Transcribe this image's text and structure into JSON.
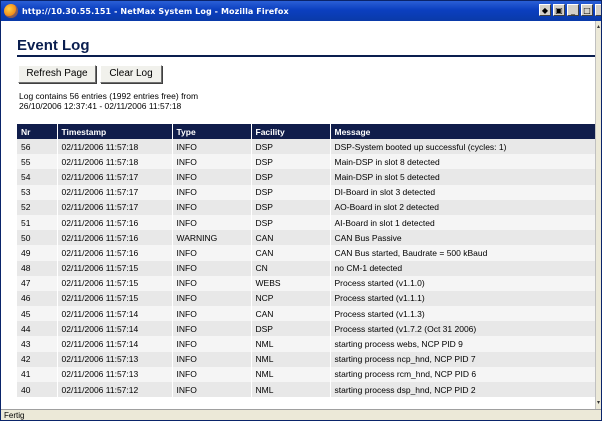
{
  "window": {
    "title": "http://10.30.55.151 - NetMax System Log - Mozilla Firefox"
  },
  "page": {
    "title": "Event Log",
    "refresh_label": "Refresh Page",
    "clear_label": "Clear Log",
    "summary_line1": "Log contains 56 entries (1992 entries free) from",
    "summary_line2": "26/10/2006 12:37:41 - 02/11/2006 11:57:18"
  },
  "table": {
    "headers": {
      "nr": "Nr",
      "timestamp": "Timestamp",
      "type": "Type",
      "facility": "Facility",
      "message": "Message"
    },
    "rows": [
      {
        "nr": "56",
        "timestamp": "02/11/2006 11:57:18",
        "type": "INFO",
        "facility": "DSP",
        "message": "DSP-System booted up successful (cycles: 1)"
      },
      {
        "nr": "55",
        "timestamp": "02/11/2006 11:57:18",
        "type": "INFO",
        "facility": "DSP",
        "message": "Main-DSP in slot 8 detected"
      },
      {
        "nr": "54",
        "timestamp": "02/11/2006 11:57:17",
        "type": "INFO",
        "facility": "DSP",
        "message": "Main-DSP in slot 5 detected"
      },
      {
        "nr": "53",
        "timestamp": "02/11/2006 11:57:17",
        "type": "INFO",
        "facility": "DSP",
        "message": "DI-Board in slot 3 detected"
      },
      {
        "nr": "52",
        "timestamp": "02/11/2006 11:57:17",
        "type": "INFO",
        "facility": "DSP",
        "message": "AO-Board in slot 2 detected"
      },
      {
        "nr": "51",
        "timestamp": "02/11/2006 11:57:16",
        "type": "INFO",
        "facility": "DSP",
        "message": "AI-Board in slot 1 detected"
      },
      {
        "nr": "50",
        "timestamp": "02/11/2006 11:57:16",
        "type": "WARNING",
        "facility": "CAN",
        "message": "CAN Bus Passive"
      },
      {
        "nr": "49",
        "timestamp": "02/11/2006 11:57:16",
        "type": "INFO",
        "facility": "CAN",
        "message": "CAN Bus started, Baudrate = 500 kBaud"
      },
      {
        "nr": "48",
        "timestamp": "02/11/2006 11:57:15",
        "type": "INFO",
        "facility": "CN",
        "message": "no CM-1 detected"
      },
      {
        "nr": "47",
        "timestamp": "02/11/2006 11:57:15",
        "type": "INFO",
        "facility": "WEBS",
        "message": "Process started (v1.1.0)"
      },
      {
        "nr": "46",
        "timestamp": "02/11/2006 11:57:15",
        "type": "INFO",
        "facility": "NCP",
        "message": "Process started (v1.1.1)"
      },
      {
        "nr": "45",
        "timestamp": "02/11/2006 11:57:14",
        "type": "INFO",
        "facility": "CAN",
        "message": "Process started (v1.1.3)"
      },
      {
        "nr": "44",
        "timestamp": "02/11/2006 11:57:14",
        "type": "INFO",
        "facility": "DSP",
        "message": "Process started (v1.7.2 (Oct 31 2006)"
      },
      {
        "nr": "43",
        "timestamp": "02/11/2006 11:57:14",
        "type": "INFO",
        "facility": "NML",
        "message": "starting process webs, NCP PID 9"
      },
      {
        "nr": "42",
        "timestamp": "02/11/2006 11:57:13",
        "type": "INFO",
        "facility": "NML",
        "message": "starting process ncp_hnd, NCP PID 7"
      },
      {
        "nr": "41",
        "timestamp": "02/11/2006 11:57:13",
        "type": "INFO",
        "facility": "NML",
        "message": "starting process rcm_hnd, NCP PID 6"
      },
      {
        "nr": "40",
        "timestamp": "02/11/2006 11:57:12",
        "type": "INFO",
        "facility": "NML",
        "message": "starting process dsp_hnd, NCP PID 2"
      }
    ]
  },
  "statusbar": {
    "text": "Fertig"
  },
  "icons": {
    "app": "firefox-icon",
    "restore": "restore-icon",
    "minimize": "minimize-icon",
    "maximize": "maximize-icon",
    "close": "close-icon"
  },
  "colors": {
    "header_bg": "#101d4b",
    "title_color": "#0a1e4f",
    "row_odd": "#e8e8e8",
    "row_even": "#f5f5f5"
  }
}
